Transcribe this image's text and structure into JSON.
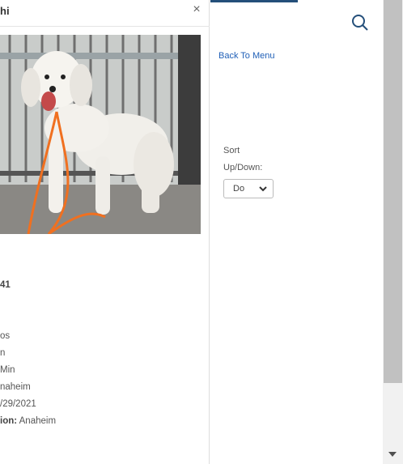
{
  "modal": {
    "title": "hi",
    "close_label": "×",
    "photo_alt": "white poodle mix dog on orange leash",
    "fields": [
      {
        "text": "41",
        "bold": true
      },
      {
        "text": "os",
        "bold": false
      },
      {
        "text": "n",
        "bold": false
      },
      {
        "text": "Min",
        "bold": false
      },
      {
        "text": "naheim",
        "bold": false
      },
      {
        "text": "/29/2021",
        "bold": false
      },
      {
        "label": "ion:",
        "value": " Anaheim"
      }
    ]
  },
  "right_panel": {
    "back_link": "Back To Menu",
    "sort_label_1": "Sort",
    "sort_label_2": "Up/Down:",
    "sort_value": "Down"
  },
  "icons": {
    "search": "search-icon",
    "chevron": "chevron-down-icon",
    "close": "close-icon"
  },
  "colors": {
    "link": "#1f5fb7",
    "tab_accent": "#244f7a",
    "icon": "#244f7a"
  }
}
